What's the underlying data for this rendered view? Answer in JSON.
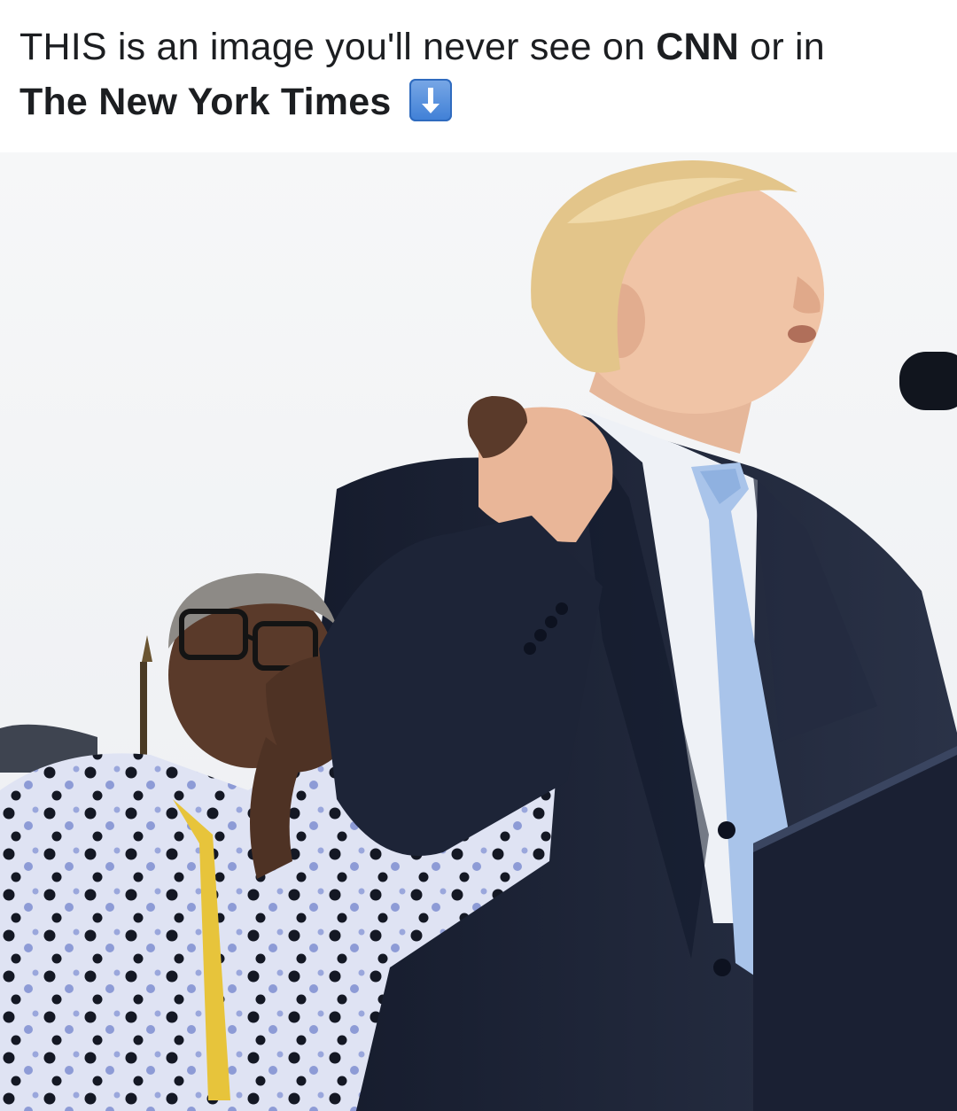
{
  "post": {
    "caption_part1": "THIS is an image you'll never see on ",
    "caption_bold1": "CNN",
    "caption_part2": " or in ",
    "caption_bold2": "The New York Times",
    "emoji_icon": "down-arrow-button-emoji"
  },
  "colors": {
    "text": "#1c1e21",
    "emoji_blue": "#3f7fd6",
    "suit": "#1b2235",
    "tie": "#a9c4ea",
    "shirt": "#eef1f6",
    "hair": "#e3c58a",
    "sky": "#f3f4f6",
    "podium": "#1a2033",
    "blouse": "#dfe3f3"
  }
}
